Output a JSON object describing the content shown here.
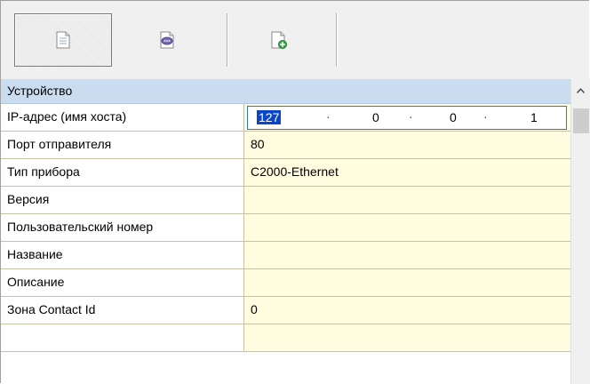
{
  "toolbar": {
    "buttons": [
      {
        "name": "properties-view",
        "icon": "document-lines-icon",
        "pressed": true
      },
      {
        "name": "comments-view",
        "icon": "document-comment-icon",
        "pressed": false
      },
      {
        "name": "add-document",
        "icon": "document-add-icon",
        "pressed": false
      }
    ]
  },
  "grid": {
    "category": "Устройство",
    "rows": [
      {
        "label": "IP-адрес (имя хоста)",
        "value": ""
      },
      {
        "label": "Порт отправителя",
        "value": "80"
      },
      {
        "label": "Тип прибора",
        "value": "C2000-Ethernet"
      },
      {
        "label": "Версия",
        "value": ""
      },
      {
        "label": "Пользовательский номер",
        "value": ""
      },
      {
        "label": "Название",
        "value": ""
      },
      {
        "label": "Описание",
        "value": ""
      },
      {
        "label": "Зона Contact Id",
        "value": "0"
      }
    ],
    "ip_editor": {
      "octets": [
        "127",
        "0",
        "0",
        "1"
      ],
      "separator": "·"
    }
  },
  "scrollbar": {
    "up_icon": "chevron-up-icon"
  },
  "colors": {
    "category_bg": "#c9dcf0",
    "value_bg": "#fffce0",
    "selection": "#0a46c8",
    "editor_border": "#2778c8"
  }
}
